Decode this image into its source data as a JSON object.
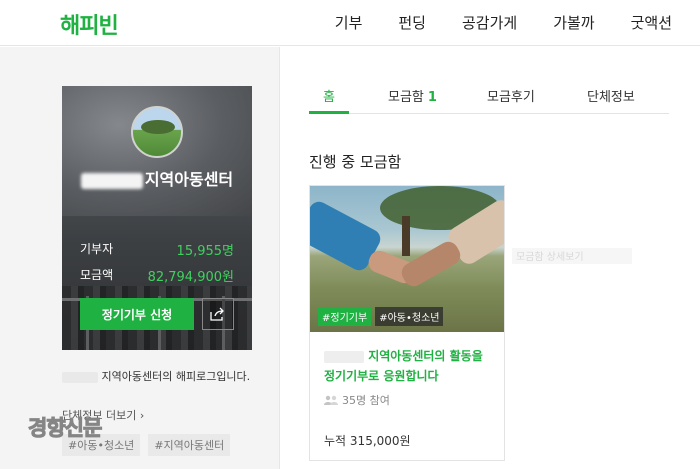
{
  "header": {
    "logo": "해피빈",
    "nav": [
      "기부",
      "펀딩",
      "공감가게",
      "가볼까",
      "굿액션"
    ]
  },
  "profile": {
    "org_name_suffix": "지역아동센터",
    "stats": [
      {
        "label": "기부자",
        "value": "15,955명"
      },
      {
        "label": "모금액",
        "value": "82,794,900원"
      }
    ],
    "donate_button": "정기기부 신청",
    "intro_text": "지역아동센터의 해피로그입니다.",
    "more_link": "단체정보 더보기 ›",
    "tags": [
      "#아동•청소년",
      "#지역아동센터"
    ]
  },
  "tabs": [
    {
      "label": "홈",
      "active": true
    },
    {
      "label": "모금함",
      "count": "1"
    },
    {
      "label": "모금후기"
    },
    {
      "label": "단체정보"
    }
  ],
  "section_title": "진행 중 모금함",
  "campaign": {
    "badges": [
      "#정기기부",
      "#아동•청소년"
    ],
    "title": "지역아동센터의 활동을 정기기부로 응원합니다",
    "participants": "35명 참여",
    "total_label": "누적",
    "total_value": "315,000원"
  },
  "ghost_text": "모금함 상세보기",
  "watermark": "경향신문",
  "colors": {
    "brand_green": "#1fb141",
    "stat_green": "#3fd15f"
  }
}
